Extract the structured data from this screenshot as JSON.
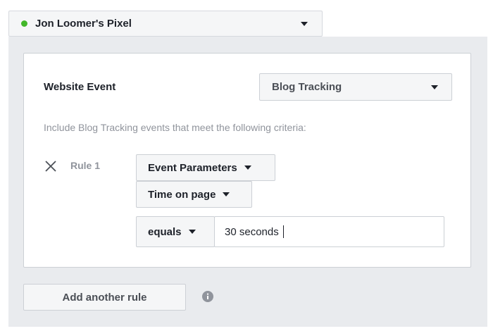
{
  "pixel": {
    "name": "Jon Loomer's Pixel",
    "status_color": "#42b72a"
  },
  "event": {
    "label": "Website Event",
    "selected": "Blog Tracking"
  },
  "criteria_text": "Include Blog Tracking events that meet the following criteria:",
  "rules": [
    {
      "label": "Rule 1",
      "source": "Event Parameters",
      "parameter": "Time on page",
      "operator": "equals",
      "value": "30 seconds"
    }
  ],
  "add_rule_label": "Add another rule",
  "icons": {
    "pixel_status": "green-dot-icon",
    "dropdown": "caret-down-icon",
    "remove": "close-icon",
    "info": "info-icon"
  },
  "colors": {
    "panel_bg": "#e9ebee",
    "button_bg": "#f5f6f7",
    "border": "#ccd0d5",
    "muted_text": "#90949c"
  }
}
